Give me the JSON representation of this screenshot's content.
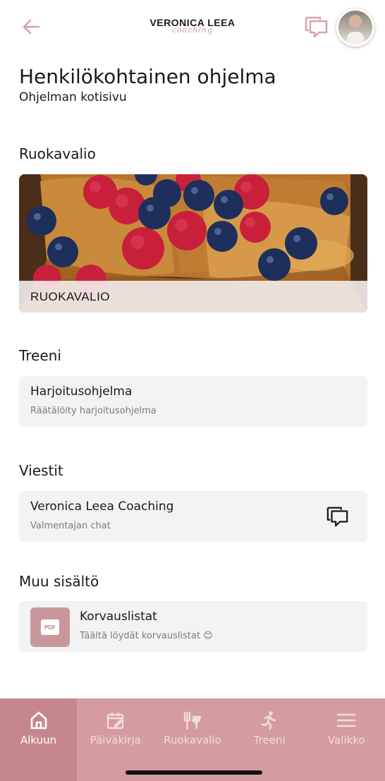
{
  "header": {
    "logo_main": "VERONICA LEEA",
    "logo_sub": "coaching"
  },
  "page": {
    "title": "Henkilökohtainen ohjelma",
    "subtitle": "Ohjelman kotisivu"
  },
  "sections": {
    "diet": {
      "heading": "Ruokavalio",
      "card_label": "RUOKAVALIO"
    },
    "training": {
      "heading": "Treeni",
      "card_title": "Harjoitusohjelma",
      "card_subtitle": "Räätälöity harjoitusohjelma"
    },
    "messages": {
      "heading": "Viestit",
      "card_title": "Veronica Leea Coaching",
      "card_subtitle": "Valmentajan chat"
    },
    "other": {
      "heading": "Muu sisältö",
      "thumb_label": "PDF",
      "card_title": "Korvauslistat",
      "card_subtitle": "Täältä löydät korvauslistat 😊"
    }
  },
  "bottom_nav": [
    {
      "label": "Alkuun",
      "icon": "home-icon",
      "active": true
    },
    {
      "label": "Päiväkirja",
      "icon": "calendar-edit-icon",
      "active": false
    },
    {
      "label": "Ruokavalio",
      "icon": "fork-knife-icon",
      "active": false
    },
    {
      "label": "Treeni",
      "icon": "running-icon",
      "active": false
    },
    {
      "label": "Valikko",
      "icon": "menu-icon",
      "active": false
    }
  ],
  "colors": {
    "accent": "#d49ca0",
    "accent_active": "#c6878c",
    "card_bg": "#f3f2f4",
    "icon_pink": "#d9a1a8"
  }
}
